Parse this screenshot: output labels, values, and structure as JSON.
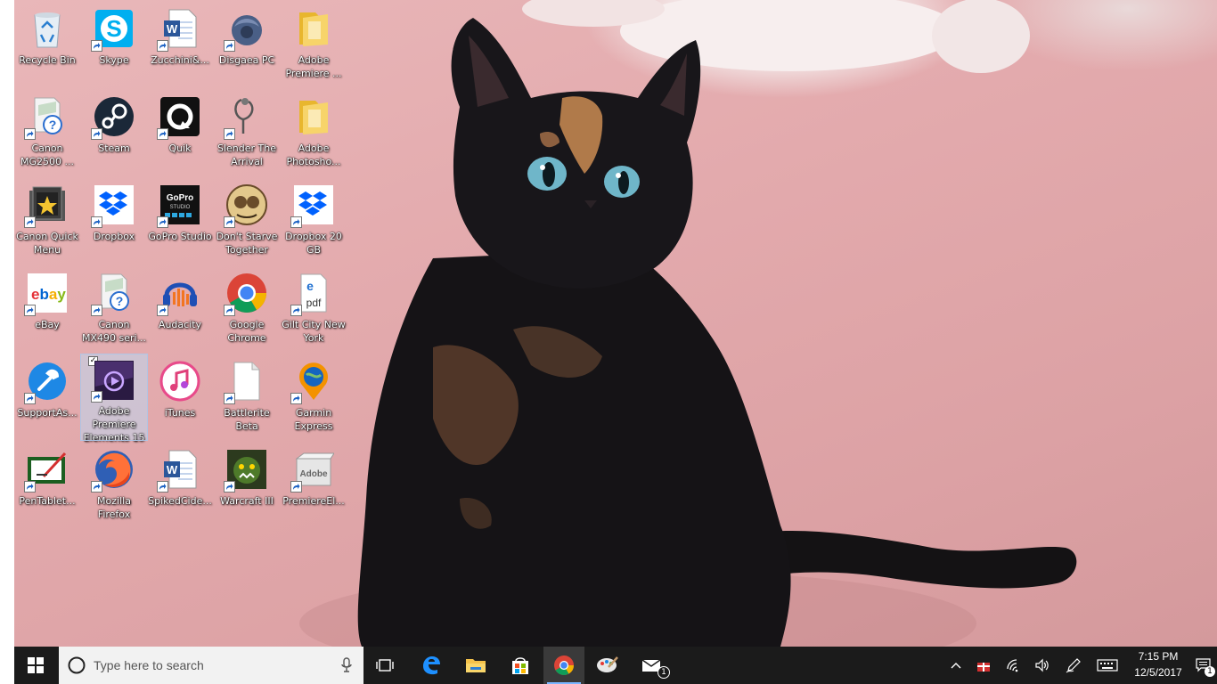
{
  "desktop": {
    "icons": [
      {
        "label": "Recycle Bin",
        "icon": "recycle-bin-icon",
        "shortcut": false
      },
      {
        "label": "Skype",
        "icon": "skype-icon",
        "shortcut": true
      },
      {
        "label": "Zucchini&...",
        "icon": "word-doc-icon",
        "shortcut": true
      },
      {
        "label": "Disgaea PC",
        "icon": "disgaea-icon",
        "shortcut": true
      },
      {
        "label": "Adobe Premiere ...",
        "icon": "folder-icon",
        "shortcut": false
      },
      {
        "label": "Canon MG2500 ...",
        "icon": "canon-help-icon",
        "shortcut": true
      },
      {
        "label": "Steam",
        "icon": "steam-icon",
        "shortcut": true
      },
      {
        "label": "Quik",
        "icon": "quik-icon",
        "shortcut": true
      },
      {
        "label": "Slender The Arrival",
        "icon": "slender-icon",
        "shortcut": true
      },
      {
        "label": "Adobe Photosho...",
        "icon": "folder-icon",
        "shortcut": false
      },
      {
        "label": "Canon Quick Menu",
        "icon": "canon-quick-menu-icon",
        "shortcut": true
      },
      {
        "label": "Dropbox",
        "icon": "dropbox-icon",
        "shortcut": true
      },
      {
        "label": "GoPro Studio",
        "icon": "gopro-icon",
        "shortcut": true
      },
      {
        "label": "Don't Starve Together",
        "icon": "dont-starve-icon",
        "shortcut": true
      },
      {
        "label": "Dropbox 20 GB",
        "icon": "dropbox-icon",
        "shortcut": true
      },
      {
        "label": "eBay",
        "icon": "ebay-icon",
        "shortcut": true
      },
      {
        "label": "Canon MX490 seri...",
        "icon": "canon-help-icon",
        "shortcut": true
      },
      {
        "label": "Audacity",
        "icon": "audacity-icon",
        "shortcut": true
      },
      {
        "label": "Google Chrome",
        "icon": "chrome-icon",
        "shortcut": true
      },
      {
        "label": "Gilt City New York",
        "icon": "pdf-icon",
        "shortcut": true
      },
      {
        "label": "SupportAs...",
        "icon": "support-assist-icon",
        "shortcut": true
      },
      {
        "label": "Adobe Premiere Elements 15",
        "icon": "premiere-elements-icon",
        "shortcut": true,
        "selected": true
      },
      {
        "label": "iTunes",
        "icon": "itunes-icon",
        "shortcut": false
      },
      {
        "label": "Battlerite Beta",
        "icon": "blank-file-icon",
        "shortcut": true
      },
      {
        "label": "Garmin Express",
        "icon": "garmin-icon",
        "shortcut": true
      },
      {
        "label": "PenTablet...",
        "icon": "pentablet-icon",
        "shortcut": true
      },
      {
        "label": "Mozilla Firefox",
        "icon": "firefox-icon",
        "shortcut": true
      },
      {
        "label": "SpikedCide...",
        "icon": "word-doc-icon",
        "shortcut": true
      },
      {
        "label": "Warcraft III",
        "icon": "warcraft-icon",
        "shortcut": true
      },
      {
        "label": "PremiereEl...",
        "icon": "adobe-box-icon",
        "shortcut": true
      }
    ]
  },
  "taskbar": {
    "search_placeholder": "Type here to search",
    "pinned": [
      {
        "name": "task-view",
        "icon": "task-view-icon"
      },
      {
        "name": "edge",
        "icon": "edge-icon"
      },
      {
        "name": "file-explorer",
        "icon": "folder-icon"
      },
      {
        "name": "store",
        "icon": "store-icon"
      },
      {
        "name": "chrome",
        "icon": "chrome-icon",
        "active": true
      },
      {
        "name": "paint",
        "icon": "paint-icon"
      },
      {
        "name": "mail",
        "icon": "mail-icon",
        "badge": "1"
      }
    ],
    "clock": {
      "time": "7:15 PM",
      "date": "12/5/2017"
    },
    "notification_count": "1"
  },
  "colors": {
    "taskbar_bg": "#1b1b1b",
    "wallpaper_pink": "#e3aaad",
    "accent_blue": "#0078d7",
    "selection": "#bed7f0"
  }
}
